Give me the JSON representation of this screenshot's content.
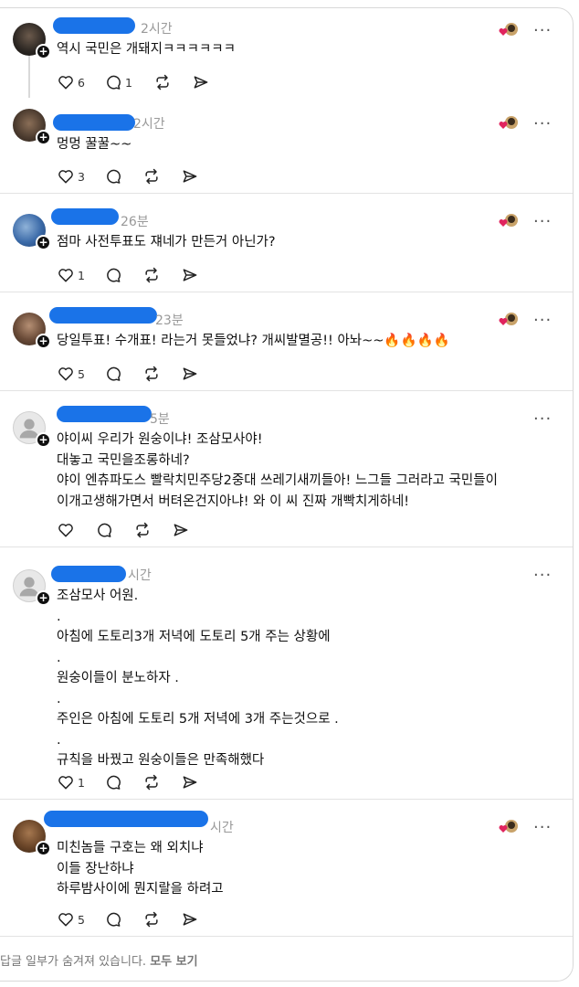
{
  "posts": [
    {
      "time": "2시간",
      "lines": [
        "역시 국민은 개돼지ㅋㅋㅋㅋㅋㅋ"
      ],
      "likes": "6",
      "replies": "1",
      "has_badge": true
    },
    {
      "time": "2시간",
      "lines": [
        "멍멍 꿀꿀~~"
      ],
      "likes": "3",
      "replies": "",
      "has_badge": true
    },
    {
      "time": "26분",
      "lines": [
        "점마 사전투표도 쟤네가 만든거 아닌가?"
      ],
      "likes": "1",
      "replies": "",
      "has_badge": true
    },
    {
      "time": "23분",
      "lines": [
        "당일투표! 수개표! 라는거 못들었냐? 개씨발멸공!! 아놔~~🔥🔥🔥🔥"
      ],
      "likes": "5",
      "replies": "",
      "has_badge": true
    },
    {
      "time": "5분",
      "lines": [
        "야이씨 우리가 원숭이냐! 조삼모사야!",
        "대놓고 국민을조롱하네?",
        "야이 엔츄파도스 빨락치민주당2중대 쓰레기새끼들아! 느그들 그러라고 국민들이",
        "이개고생해가면서 버텨온건지아냐! 와 이 씨 진짜 개빡치게하네!"
      ],
      "likes": "",
      "replies": "",
      "has_badge": false
    },
    {
      "time": "시간",
      "lines": [
        "조삼모사 어원.",
        ".",
        "아침에 도토리3개 저녁에 도토리 5개 주는 상황에",
        ".",
        "원숭이들이 분노하자 .",
        ".",
        "주인은 아침에 도토리 5개 저녁에 3개 주는것으로 .",
        ".",
        "규칙을 바꿨고 원숭이들은 만족해했다"
      ],
      "likes": "1",
      "replies": "",
      "has_badge": false
    },
    {
      "time": "시간",
      "lines": [
        "미친놈들 구호는 왜 외치냐",
        "이들 장난하냐",
        "하루밤사이에 뭔지랄을 하려고"
      ],
      "likes": "5",
      "replies": "",
      "has_badge": true
    }
  ],
  "footer": {
    "text": "답글 일부가 숨겨져 있습니다. ",
    "link": "모두 보기"
  },
  "colors": {
    "redact": "#1a73e8",
    "heart": "#e0245e"
  }
}
